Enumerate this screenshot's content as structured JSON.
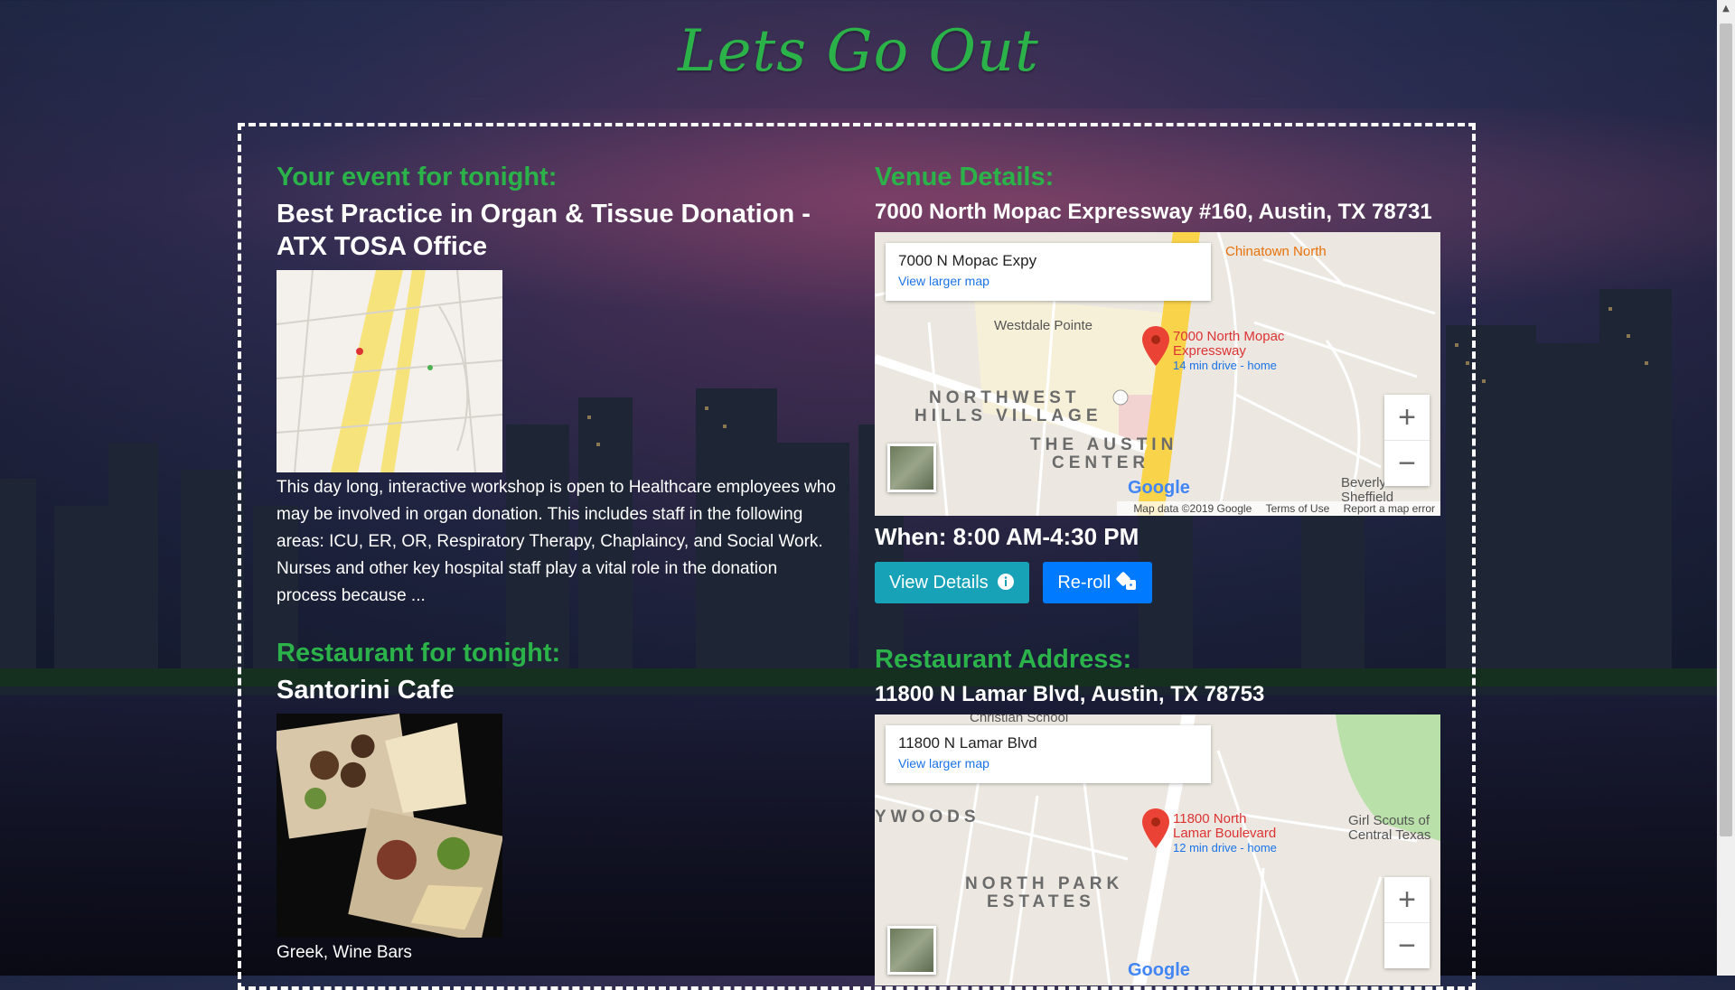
{
  "title": "Lets Go Out",
  "event": {
    "heading": "Your event for tonight:",
    "name": "Best Practice in Organ & Tissue Donation - ATX TOSA Office",
    "description": "This day long, interactive workshop is open to Healthcare employees who may be involved in organ donation. This includes staff in the following areas: ICU, ER, OR, Respiratory Therapy, Chaplaincy, and Social Work. Nurses and other key hospital staff play a vital role in the donation process because ..."
  },
  "venue": {
    "heading": "Venue Details:",
    "address": "7000 North Mopac Expressway #160, Austin, TX 78731",
    "map": {
      "place": "7000 N Mopac Expy",
      "link": "View larger map",
      "pin_label_1": "7000 North Mopac",
      "pin_label_2": "Expressway",
      "drive": "14 min drive - home",
      "area_1": "NORTHWEST",
      "area_2": "HILLS VILLAGE",
      "area_3": "THE AUSTIN",
      "area_4": "CENTER",
      "poi_1": "Westdale Pointe",
      "poi_2": "Chinatown North",
      "poi_3": "Beverly Sheffield",
      "footer_data": "Map data ©2019 Google",
      "footer_terms": "Terms of Use",
      "footer_report": "Report a map error",
      "google": "Google"
    },
    "when": "When: 8:00 AM-4:30 PM",
    "view_details": "View Details",
    "reroll": "Re-roll"
  },
  "restaurant": {
    "heading": "Restaurant for tonight:",
    "name": "Santorini Cafe",
    "tags": "Greek, Wine Bars"
  },
  "restaurant_address": {
    "heading": "Restaurant Address:",
    "address": "11800 N Lamar Blvd, Austin, TX 78753",
    "map": {
      "place": "11800 N Lamar Blvd",
      "link": "View larger map",
      "pin_label_1": "11800 North",
      "pin_label_2": "Lamar Boulevard",
      "drive": "12 min drive - home",
      "area_1": "NORTH PARK",
      "area_2": "ESTATES",
      "area_3": "YWOODS",
      "poi_1": "Girl Scouts of Central Texas",
      "poi_2": "Christian School",
      "google": "Google"
    }
  },
  "colors": {
    "accent_green": "#2bb34a",
    "teal": "#17a2b8",
    "blue": "#007bff"
  }
}
